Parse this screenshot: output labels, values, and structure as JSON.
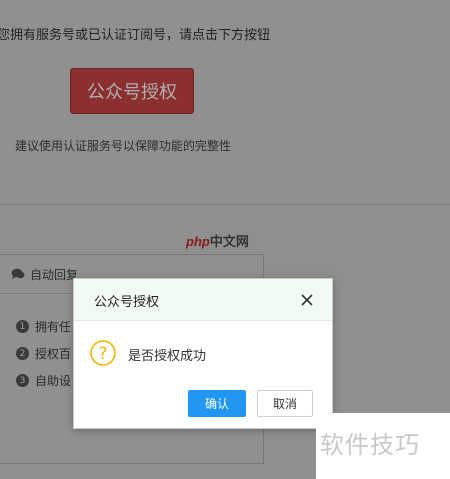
{
  "page": {
    "instruction": "您拥有服务号或已认证订阅号，请点击下方按钮",
    "auth_button_label": "公众号授权",
    "suggestion": "建议使用认证服务号以保障功能的完整性"
  },
  "watermark": {
    "p": "php",
    "c": "中文网"
  },
  "panel": {
    "title": "自动回复",
    "steps": [
      {
        "num": "1",
        "label": "拥有任"
      },
      {
        "num": "2",
        "label": "授权百"
      },
      {
        "num": "3",
        "label": "自助设"
      }
    ]
  },
  "dialog": {
    "title": "公众号授权",
    "message": "是否授权成功",
    "confirm_label": "确认",
    "cancel_label": "取消",
    "icon": "question-icon",
    "accent": "#2196f3"
  },
  "brand": {
    "text": "软件技巧"
  }
}
